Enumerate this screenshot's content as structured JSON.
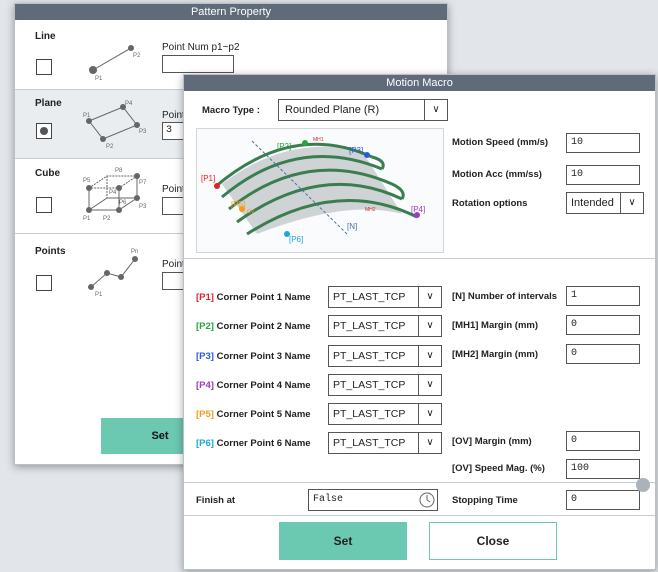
{
  "pattern_property": {
    "title": "Pattern Property",
    "sections": [
      {
        "label": "Line",
        "point_label": "Point Num p1~p2",
        "value": "",
        "checked": false
      },
      {
        "label": "Plane",
        "point_label": "Point",
        "value": "3",
        "checked": true
      },
      {
        "label": "Cube",
        "point_label": "Point",
        "value": "",
        "checked": false
      },
      {
        "label": "Points",
        "point_label": "Point",
        "value": "",
        "checked": false
      }
    ],
    "set_label": "Set"
  },
  "motion_macro": {
    "title": "Motion Macro",
    "macro_type_label": "Macro Type :",
    "macro_type_value": "Rounded Plane (R)",
    "motion_speed_label": "Motion Speed (mm/s)",
    "motion_speed_value": "10",
    "motion_acc_label": "Motion Acc (mm/ss)",
    "motion_acc_value": "10",
    "rotation_label": "Rotation options",
    "rotation_value": "Intended",
    "diagram_labels": {
      "p1": "[P1]",
      "p2": "[P2]",
      "p3": "[P3]",
      "p4": "[P4]",
      "p5": "[P5]",
      "p6": "[P6]",
      "n": "[N]",
      "mh1": "MH1",
      "mh2": "MH2",
      "ov": "OV"
    },
    "corner_points": [
      {
        "tag": "[P1]",
        "color": "#e0232b",
        "name": "Corner Point 1 Name",
        "value": "PT_LAST_TCP"
      },
      {
        "tag": "[P2]",
        "color": "#27a63c",
        "name": "Corner Point 2 Name",
        "value": "PT_LAST_TCP"
      },
      {
        "tag": "[P3]",
        "color": "#2a5bd7",
        "name": "Corner Point 3 Name",
        "value": "PT_LAST_TCP"
      },
      {
        "tag": "[P4]",
        "color": "#9b3cc2",
        "name": "Corner Point 4 Name",
        "value": "PT_LAST_TCP"
      },
      {
        "tag": "[P5]",
        "color": "#f29b1d",
        "name": "Corner Point 5 Name",
        "value": "PT_LAST_TCP"
      },
      {
        "tag": "[P6]",
        "color": "#1ca7d8",
        "name": "Corner Point 6 Name",
        "value": "PT_LAST_TCP"
      }
    ],
    "intervals_label": "[N] Number of intervals",
    "intervals_value": "1",
    "mh1_label": "[MH1] Margin (mm)",
    "mh1_value": "0",
    "mh2_label": "[MH2] Margin (mm)",
    "mh2_value": "0",
    "ov_margin_label": "[OV] Margin (mm)",
    "ov_margin_value": "0",
    "ov_speed_label": "[OV] Speed Mag. (%)",
    "ov_speed_value": "100",
    "finish_label": "Finish at",
    "finish_value": "False",
    "stopping_label": "Stopping Time",
    "stopping_value": "0",
    "set_label": "Set",
    "close_label": "Close"
  }
}
